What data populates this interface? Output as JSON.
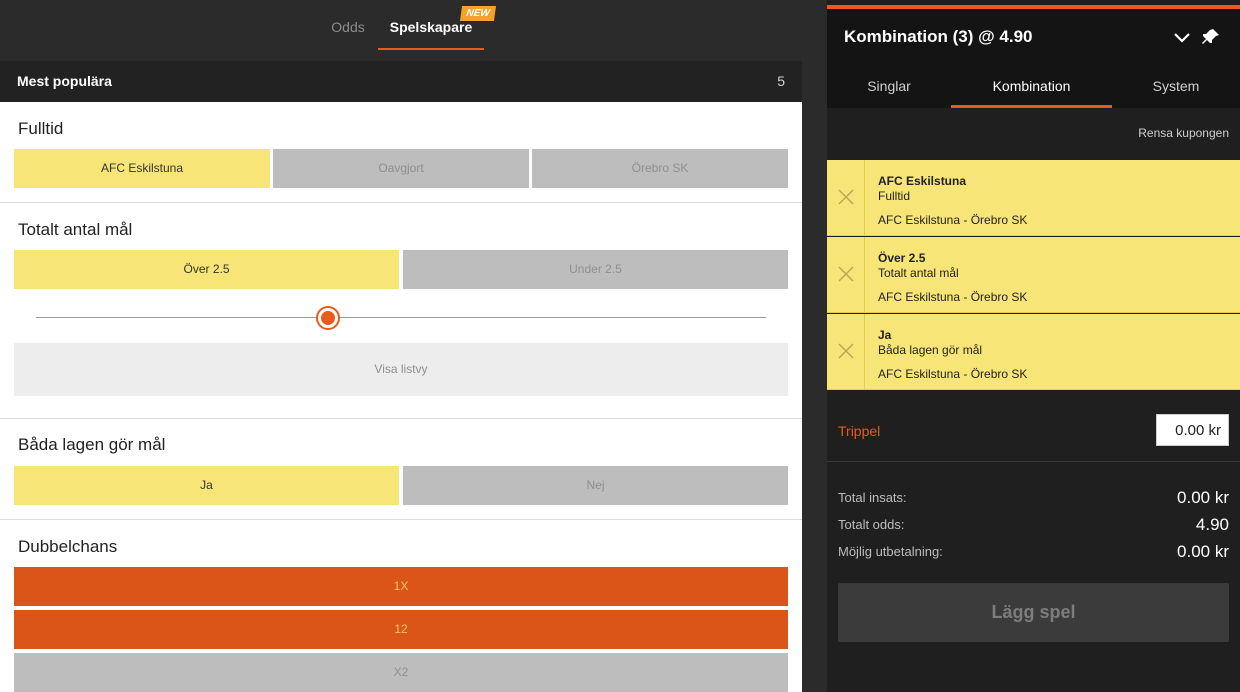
{
  "top_tabs": {
    "odds": "Odds",
    "builder": "Spelskapare",
    "new_badge": "NEW"
  },
  "panel": {
    "title": "Mest populära",
    "count": "5",
    "markets": {
      "fulltime": {
        "title": "Fulltid",
        "options": [
          "AFC Eskilstuna",
          "Oavgjort",
          "Örebro SK"
        ]
      },
      "total_goals": {
        "title": "Totalt antal mål",
        "options": [
          "Över 2.5",
          "Under 2.5"
        ],
        "show_list": "Visa listvy",
        "slider_value": 0.4
      },
      "btts": {
        "title": "Båda lagen gör mål",
        "options": [
          "Ja",
          "Nej"
        ]
      },
      "double_chance": {
        "title": "Dubbelchans",
        "options": [
          "1X",
          "12",
          "X2"
        ]
      }
    }
  },
  "betslip": {
    "title": "Kombination (3) @ 4.90",
    "tabs": [
      "Singlar",
      "Kombination",
      "System"
    ],
    "clear": "Rensa kupongen",
    "bets": [
      {
        "selection": "AFC Eskilstuna",
        "market": "Fulltid",
        "event": "AFC Eskilstuna - Örebro SK"
      },
      {
        "selection": "Över 2.5",
        "market": "Totalt antal mål",
        "event": "AFC Eskilstuna - Örebro SK"
      },
      {
        "selection": "Ja",
        "market": "Båda lagen gör mål",
        "event": "AFC Eskilstuna - Örebro SK"
      }
    ],
    "bet_type": "Trippel",
    "stake_value": "0.00 kr",
    "summary": {
      "total_stake_label": "Total insats:",
      "total_stake": "0.00 kr",
      "total_odds_label": "Totalt odds:",
      "total_odds": "4.90",
      "payout_label": "Möjlig utbetalning:",
      "payout": "0.00 kr"
    },
    "place_bet": "Lägg spel"
  },
  "colors": {
    "accent": "#e85b1b",
    "selected": "#f8e577",
    "disabled": "#bdbdbd"
  }
}
